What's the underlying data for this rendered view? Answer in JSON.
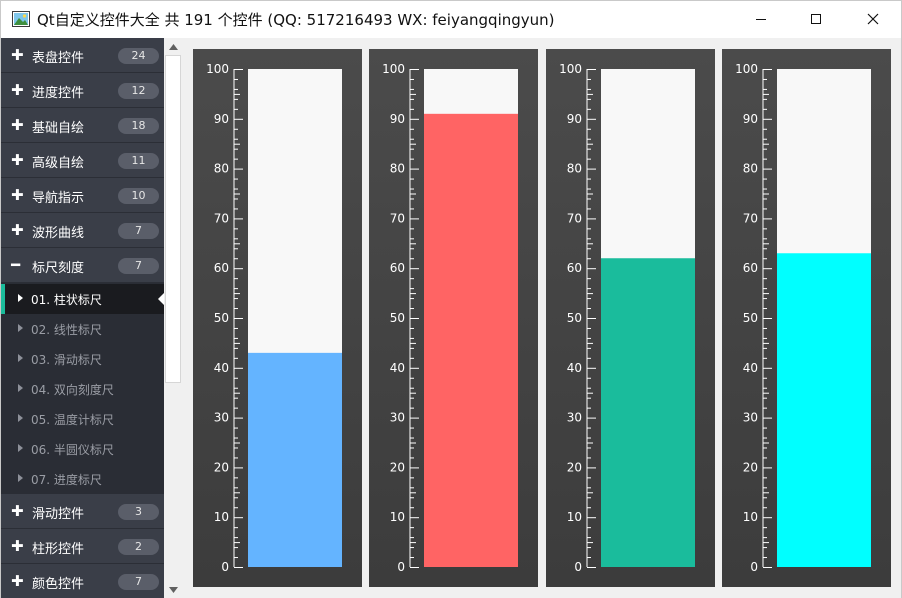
{
  "window": {
    "title": "Qt自定义控件大全 共 191 个控件 (QQ: 517216493 WX: feiyangqingyun)",
    "icon": "app-picture-icon",
    "controls": [
      "minimize-icon",
      "maximize-icon",
      "close-icon"
    ]
  },
  "sidebar": {
    "groups_top": [
      {
        "label": "表盘控件",
        "count": "24"
      },
      {
        "label": "进度控件",
        "count": "12"
      },
      {
        "label": "基础自绘",
        "count": "18"
      },
      {
        "label": "高级自绘",
        "count": "11"
      },
      {
        "label": "导航指示",
        "count": "10"
      },
      {
        "label": "波形曲线",
        "count": "7"
      }
    ],
    "expanded_group": {
      "label": "标尺刻度",
      "count": "7"
    },
    "children": [
      {
        "label": "01. 柱状标尺",
        "active": true
      },
      {
        "label": "02. 线性标尺",
        "active": false
      },
      {
        "label": "03. 滑动标尺",
        "active": false
      },
      {
        "label": "04. 双向刻度尺",
        "active": false
      },
      {
        "label": "05. 温度计标尺",
        "active": false
      },
      {
        "label": "06. 半圆仪标尺",
        "active": false
      },
      {
        "label": "07. 进度标尺",
        "active": false
      }
    ],
    "groups_bottom": [
      {
        "label": "滑动控件",
        "count": "3"
      },
      {
        "label": "柱形控件",
        "count": "2"
      },
      {
        "label": "颜色控件",
        "count": "7"
      }
    ]
  },
  "rulers": {
    "min": 0,
    "max": 100,
    "tick_labels": [
      "100",
      "90",
      "80",
      "70",
      "60",
      "50",
      "40",
      "30",
      "20",
      "10",
      "0"
    ],
    "background_color": "#f8f8f8",
    "items": [
      {
        "value": 43,
        "color": "#64b4ff"
      },
      {
        "value": 91,
        "color": "#ff6464"
      },
      {
        "value": 62,
        "color": "#1abc9c"
      },
      {
        "value": 63,
        "color": "#00ffff"
      }
    ]
  }
}
